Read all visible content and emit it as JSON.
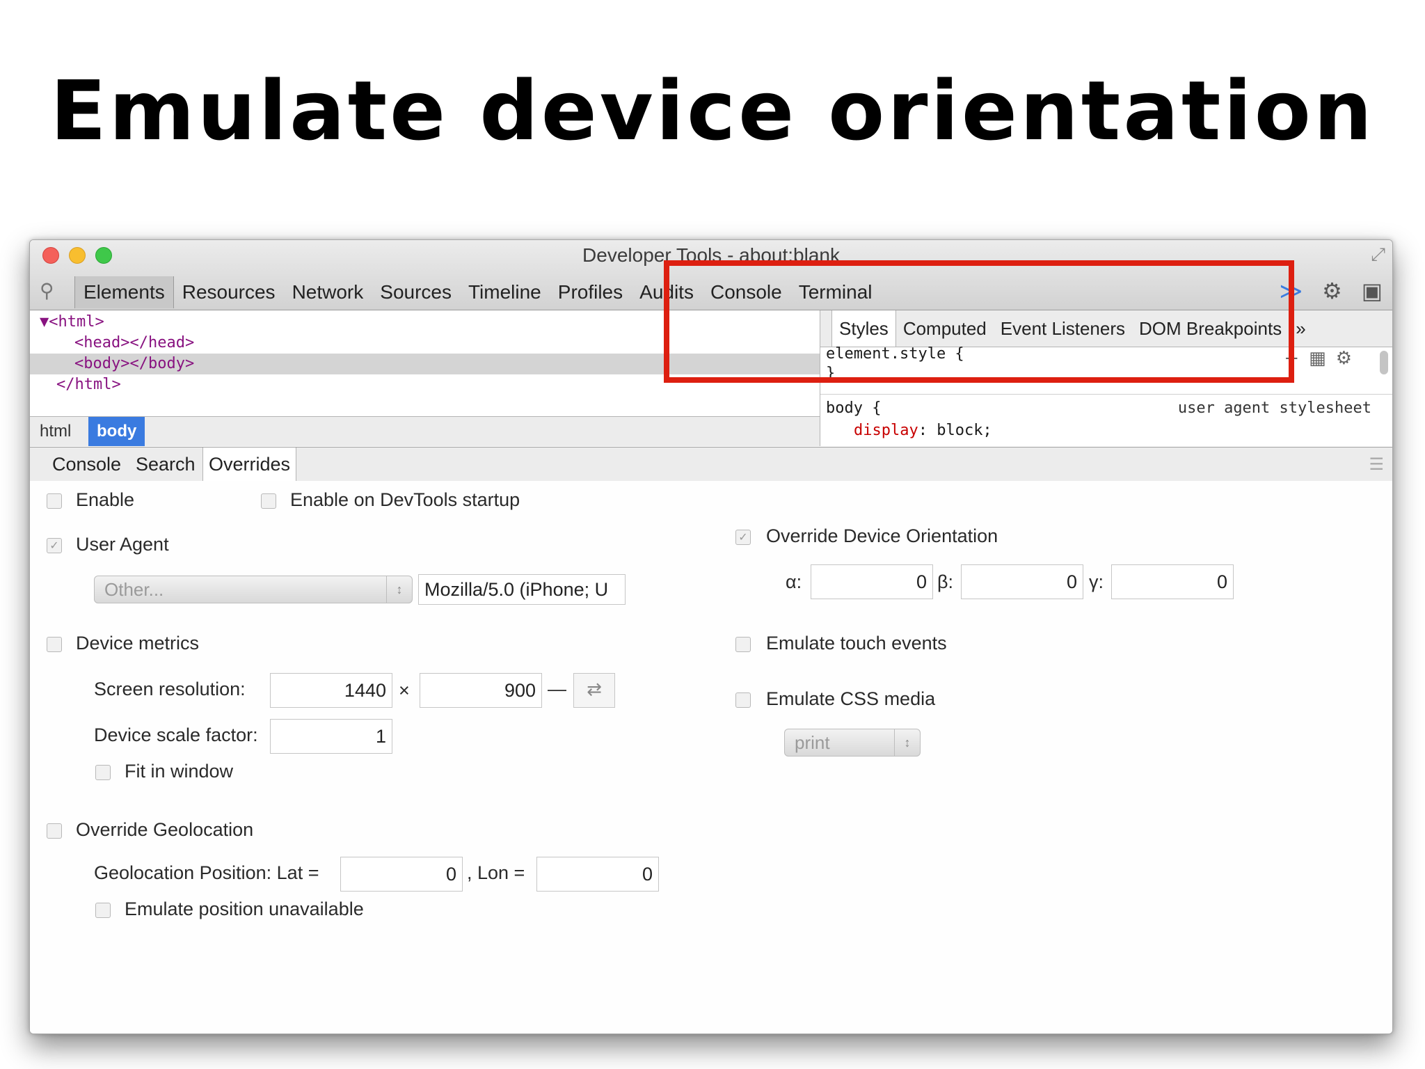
{
  "slide": {
    "title": "Emulate device orientation"
  },
  "window": {
    "title": "Developer Tools - about:blank",
    "icons": {
      "search": "search-icon",
      "console": "show-console-icon",
      "settings": "gear-icon",
      "dock": "dock-icon",
      "resize": "resize-icon"
    }
  },
  "main_tabs": [
    "Elements",
    "Resources",
    "Network",
    "Sources",
    "Timeline",
    "Profiles",
    "Audits",
    "Console",
    "Terminal"
  ],
  "elements": {
    "lines": [
      "▼<html>",
      "<head></head>",
      "<body></body>",
      "</html>"
    ],
    "breadcrumb": [
      "html",
      "body"
    ]
  },
  "styles": {
    "tabs": [
      "Styles",
      "Computed",
      "Event Listeners",
      "DOM Breakpoints",
      "»"
    ],
    "element_style_open": "element.style {",
    "close_brace": "}",
    "body_rule": "body {",
    "source": "user agent stylesheet",
    "prop": "display",
    "value": ": block;"
  },
  "drawer_tabs": [
    "Console",
    "Search",
    "Overrides"
  ],
  "overrides": {
    "enable": "Enable",
    "enable_startup": "Enable on DevTools startup",
    "user_agent": "User Agent",
    "ua_select": "Other...",
    "ua_string": "Mozilla/5.0 (iPhone; U",
    "device_metrics": "Device metrics",
    "screen_res_label": "Screen resolution:",
    "res_width": "1440",
    "res_x": "×",
    "res_height": "900",
    "res_dash": "—",
    "swap": "⇄",
    "scale_label": "Device scale factor:",
    "scale_value": "1",
    "fit_window": "Fit in window",
    "geolocation": "Override Geolocation",
    "geo_label": "Geolocation Position: Lat =",
    "lat": "0",
    "lon_label": ", Lon =",
    "lon": "0",
    "position_unavailable": "Emulate position unavailable",
    "orientation": "Override Device Orientation",
    "alpha_label": "α:",
    "alpha": "0",
    "beta_label": "β:",
    "beta": "0",
    "gamma_label": "γ:",
    "gamma": "0",
    "touch": "Emulate touch events",
    "css_media": "Emulate CSS media",
    "css_media_select": "print"
  },
  "colors": {
    "highlight": "#dd1f10",
    "selected_crumb": "#3a7be0"
  }
}
